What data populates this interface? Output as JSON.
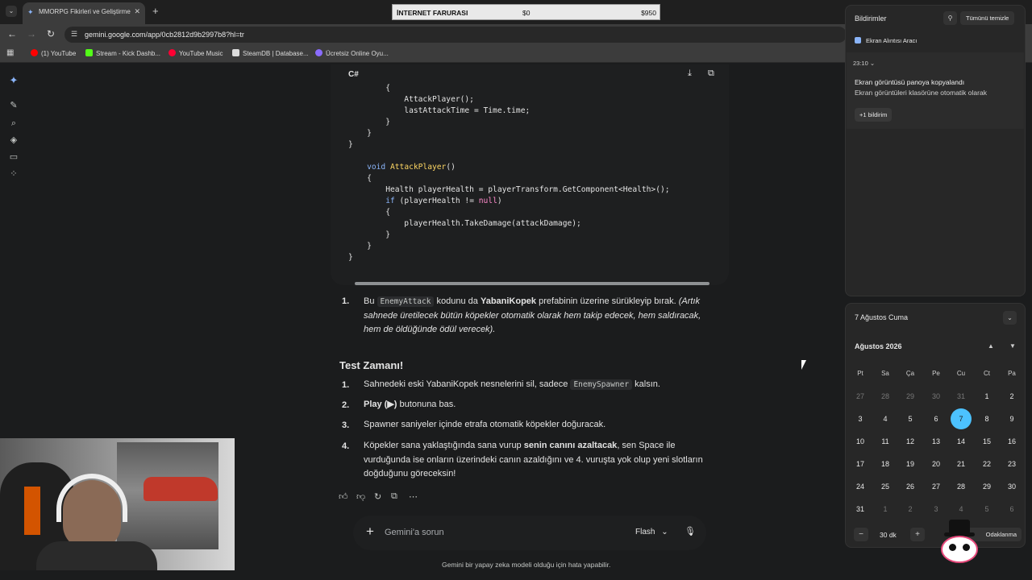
{
  "browser": {
    "tab_title": "MMORPG Fikirleri ve Geliştirme",
    "url": "gemini.google.com/app/0cb2812d9b2997b8?hl=tr",
    "bookmarks": [
      {
        "label": "(1) YouTube",
        "color": "#ff0000"
      },
      {
        "label": "Stream - Kick Dashb...",
        "color": "#53fc18"
      },
      {
        "label": "YouTube Music",
        "color": "#ff0033"
      },
      {
        "label": "SteamDB | Database...",
        "color": "#dddddd"
      },
      {
        "label": "Ücretsiz Online Oyu...",
        "color": "#8a6cff"
      }
    ]
  },
  "overlay": {
    "label": "İNTERNET FARURASI",
    "left_value": "$0",
    "right_value": "$950"
  },
  "code": {
    "language": "C#",
    "lines": [
      "        {",
      "            AttackPlayer();",
      "            lastAttackTime = Time.time;",
      "        }",
      "    }",
      "}",
      "",
      "    void AttackPlayer()",
      "    {",
      "        Health playerHealth = playerTransform.GetComponent<Health>();",
      "        if (playerHealth != null)",
      "        {",
      "            playerHealth.TakeDamage(attackDamage);",
      "        }",
      "    }",
      "}"
    ]
  },
  "response": {
    "step1": {
      "num": "1.",
      "pre": "Bu",
      "code": "EnemyAttack",
      "mid": "kodunu da",
      "bold": "YabaniKopek",
      "post": "prefabinin üzerine sürükleyip bırak.",
      "italic": "(Artık sahnede üretilecek bütün köpekler otomatik olarak hem takip edecek, hem saldıracak, hem de öldüğünde ödül verecek)."
    },
    "test_heading": "Test Zamanı!",
    "test_items": [
      {
        "num": "1.",
        "pre": "Sahnedeki eski YabaniKopek nesnelerini sil, sadece",
        "code": "EnemySpawner",
        "post": "kalsın."
      },
      {
        "num": "2.",
        "bold": "Play (▶)",
        "post": "butonuna bas."
      },
      {
        "num": "3.",
        "text": "Spawner saniyeler içinde etrafa otomatik köpekler doğuracak."
      },
      {
        "num": "4.",
        "pre": "Köpekler sana yaklaştığında sana vurup",
        "bold": "senin canını azaltacak",
        "post": ", sen Space ile vurduğunda ise onların üzerindeki canın azaldığını ve 4. vuruşta yok olup yeni slotların doğduğunu göreceksin!"
      }
    ]
  },
  "input": {
    "placeholder": "Gemini'a sorun",
    "model": "Flash",
    "disclaimer": "Gemini bir yapay zeka modeli olduğu için hata yapabilir."
  },
  "notifications": {
    "title": "Bildirimler",
    "clear_all": "Tümünü temizle",
    "app": "Ekran Alıntısı Aracı",
    "time": "23:10",
    "headline": "Ekran görüntüsü panoya kopyalandı",
    "body": "Ekran görüntüleri klasörüne otomatik olarak",
    "more": "+1 bildirim"
  },
  "calendar": {
    "date_label": "7 Ağustos Cuma",
    "month_label": "Ağustos 2026",
    "weekdays": [
      "Pt",
      "Sa",
      "Ça",
      "Pe",
      "Cu",
      "Ct",
      "Pa"
    ],
    "weeks": [
      [
        "27",
        "28",
        "29",
        "30",
        "31",
        "1",
        "2"
      ],
      [
        "3",
        "4",
        "5",
        "6",
        "7",
        "8",
        "9"
      ],
      [
        "10",
        "11",
        "12",
        "13",
        "14",
        "15",
        "16"
      ],
      [
        "17",
        "18",
        "19",
        "20",
        "21",
        "22",
        "23"
      ],
      [
        "24",
        "25",
        "26",
        "27",
        "28",
        "29",
        "30"
      ],
      [
        "31",
        "1",
        "2",
        "3",
        "4",
        "5",
        "6"
      ]
    ],
    "today": "7",
    "focus_minutes": "30 dk",
    "focus_label": "Odaklanma"
  }
}
